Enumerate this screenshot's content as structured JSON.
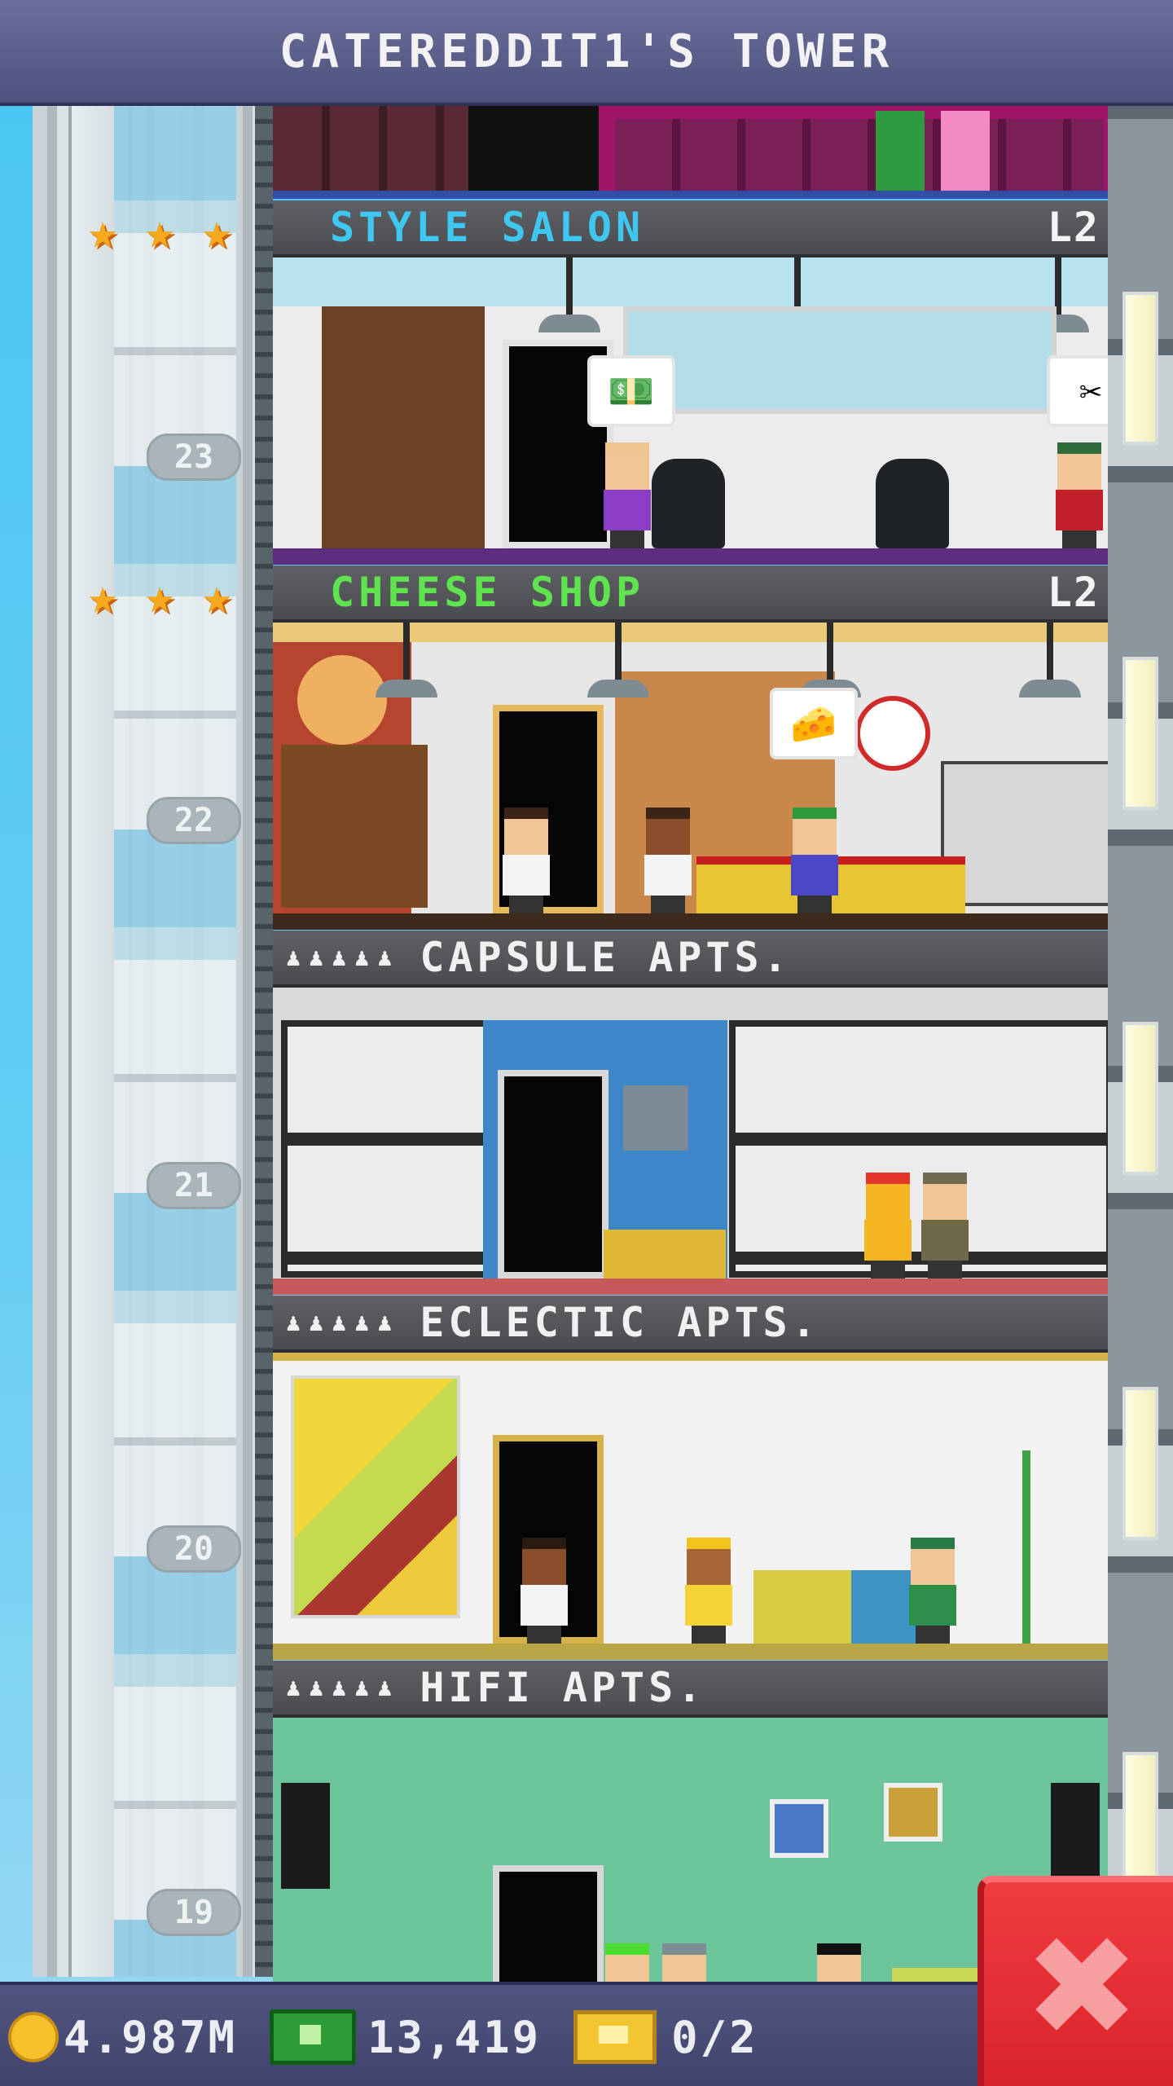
{
  "title": "CATEREDDIT1'S TOWER",
  "floors": [
    {
      "name": "STYLE SALON",
      "level": "L2",
      "stars": 3,
      "number": "23",
      "name_color": "#3fc7f2"
    },
    {
      "name": "CHEESE SHOP",
      "level": "L2",
      "stars": 3,
      "number": "22",
      "name_color": "#5fe44f"
    },
    {
      "name": "CAPSULE APTS.",
      "number": "21",
      "residents_icon": "♟♟♟♟♟"
    },
    {
      "name": "ECLECTIC APTS.",
      "number": "20",
      "residents_icon": "♟♟♟♟♟"
    },
    {
      "name": "HIFI APTS.",
      "number": "19",
      "residents_icon": "♟♟♟♟♟"
    }
  ],
  "star_glyph": "★",
  "status": {
    "coins": "4.987M",
    "bux": "13,419",
    "tickets": "0/2"
  },
  "close_button": "✖",
  "colors": {
    "titlebar": "#4d527d",
    "statusbar": "#40446c",
    "close_button": "#e02a30"
  }
}
